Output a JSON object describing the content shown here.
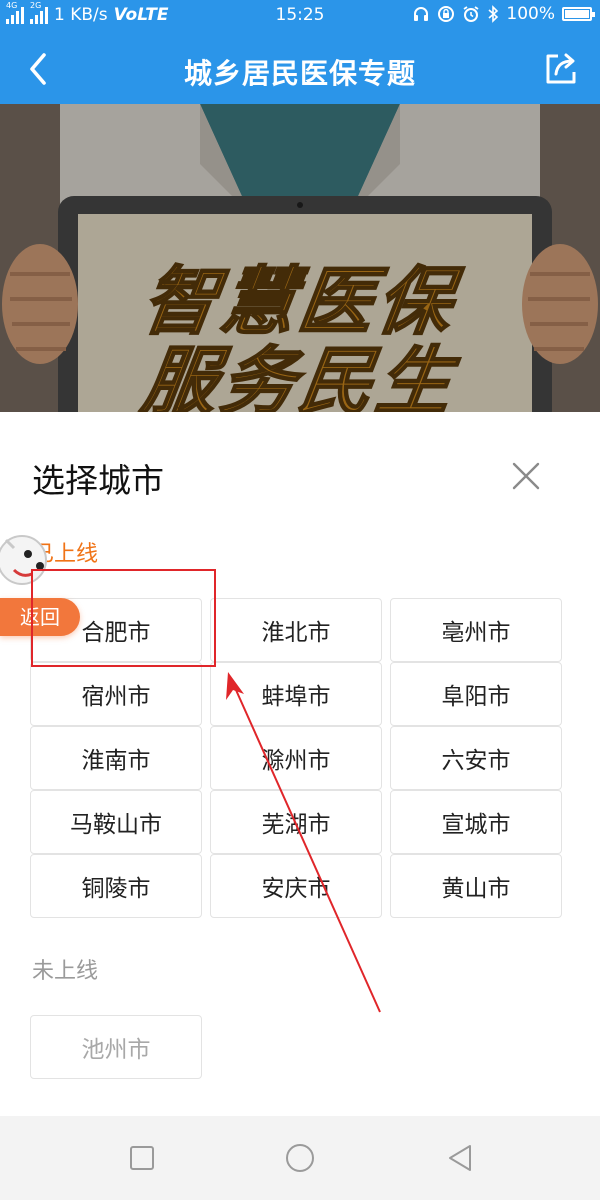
{
  "status_bar": {
    "net_speed": "1 KB/s",
    "volte": "VoLTE",
    "time": "15:25",
    "battery": "100%",
    "sim1_tag": "4G",
    "sim2_tag": "2G",
    "icons": [
      "headset-icon",
      "alarm-lock-icon",
      "alarm-clock-icon",
      "bluetooth-icon",
      "battery-icon"
    ]
  },
  "header": {
    "title": "城乡居民医保专题",
    "back_icon": "chevron-left-icon",
    "share_icon": "share-icon"
  },
  "banner": {
    "line1": "智慧医保",
    "line2": "服务民生"
  },
  "sheet": {
    "title": "选择城市",
    "close_icon": "close-icon",
    "online_label": "已上线",
    "offline_label": "未上线",
    "online_cities": [
      "合肥市",
      "淮北市",
      "亳州市",
      "宿州市",
      "蚌埠市",
      "阜阳市",
      "淮南市",
      "滁州市",
      "六安市",
      "马鞍山市",
      "芜湖市",
      "宣城市",
      "铜陵市",
      "安庆市",
      "黄山市"
    ],
    "offline_cities": [
      "池州市"
    ]
  },
  "float_widget": {
    "label": "返回"
  },
  "colors": {
    "brand_blue": "#2b95e9",
    "online_orange": "#f07316",
    "annotation_red": "#e0262a",
    "return_orange": "#f2773c"
  }
}
